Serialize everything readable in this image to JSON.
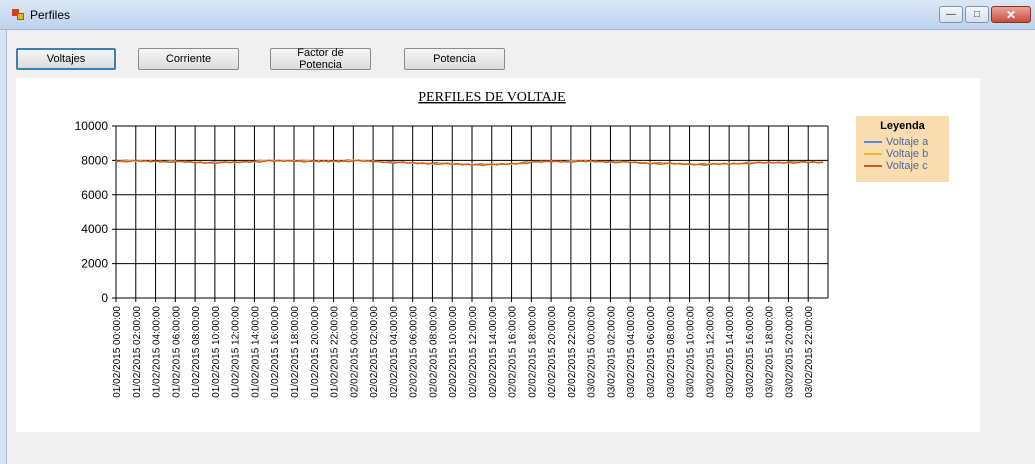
{
  "window": {
    "title": "Perfiles",
    "controls": [
      "minimize",
      "maximize",
      "close"
    ]
  },
  "toolbar": {
    "buttons": [
      {
        "label": "Voltajes",
        "active": true
      },
      {
        "label": "Corriente",
        "active": false
      },
      {
        "label": "Factor de Potencia",
        "active": false
      },
      {
        "label": "Potencia",
        "active": false
      }
    ]
  },
  "legend": {
    "title": "Leyenda",
    "items": [
      {
        "label": "Voltaje a",
        "color": "#4a90d9"
      },
      {
        "label": "Voltaje b",
        "color": "#f4b820"
      },
      {
        "label": "Voltaje c",
        "color": "#d9531e"
      }
    ]
  },
  "chart_data": {
    "type": "line",
    "title": "PERFILES DE VOLTAJE",
    "xlabel": "",
    "ylabel": "",
    "ylim": [
      0,
      10000
    ],
    "yticks": [
      0,
      2000,
      4000,
      6000,
      8000,
      10000
    ],
    "grid": true,
    "legend_position": "top-right",
    "categories": [
      "01/02/2015 00:00:00",
      "01/02/2015 02:00:00",
      "01/02/2015 04:00:00",
      "01/02/2015 06:00:00",
      "01/02/2015 08:00:00",
      "01/02/2015 10:00:00",
      "01/02/2015 12:00:00",
      "01/02/2015 14:00:00",
      "01/02/2015 16:00:00",
      "01/02/2015 18:00:00",
      "01/02/2015 20:00:00",
      "01/02/2015 22:00:00",
      "02/02/2015 00:00:00",
      "02/02/2015 02:00:00",
      "02/02/2015 04:00:00",
      "02/02/2015 06:00:00",
      "02/02/2015 08:00:00",
      "02/02/2015 10:00:00",
      "02/02/2015 12:00:00",
      "02/02/2015 14:00:00",
      "02/02/2015 16:00:00",
      "02/02/2015 18:00:00",
      "02/02/2015 20:00:00",
      "02/02/2015 22:00:00",
      "03/02/2015 00:00:00",
      "03/02/2015 02:00:00",
      "03/02/2015 04:00:00",
      "03/02/2015 06:00:00",
      "03/02/2015 08:00:00",
      "03/02/2015 10:00:00",
      "03/02/2015 12:00:00",
      "03/02/2015 14:00:00",
      "03/02/2015 16:00:00",
      "03/02/2015 18:00:00",
      "03/02/2015 20:00:00",
      "03/02/2015 22:00:00"
    ],
    "series": [
      {
        "name": "Voltaje a",
        "color": "#4a90d9",
        "values": [
          7980,
          7970,
          7960,
          7940,
          7900,
          7880,
          7900,
          7960,
          7980,
          7990,
          7950,
          7970,
          7990,
          7960,
          7900,
          7860,
          7840,
          7800,
          7780,
          7760,
          7820,
          7900,
          7960,
          7950,
          7960,
          7930,
          7900,
          7850,
          7820,
          7800,
          7780,
          7820,
          7860,
          7880,
          7900,
          7900
        ]
      },
      {
        "name": "Voltaje b",
        "color": "#f4b820",
        "values": [
          7970,
          7960,
          7950,
          7930,
          7890,
          7870,
          7890,
          7950,
          7970,
          7980,
          7940,
          7960,
          7980,
          7950,
          7890,
          7850,
          7830,
          7790,
          7770,
          7750,
          7810,
          7890,
          7950,
          7940,
          7950,
          7920,
          7890,
          7840,
          7810,
          7790,
          7770,
          7810,
          7850,
          7870,
          7890,
          7890
        ]
      },
      {
        "name": "Voltaje c",
        "color": "#d9531e",
        "values": [
          7960,
          7950,
          7940,
          7920,
          7880,
          7860,
          7880,
          7940,
          7960,
          7970,
          7930,
          7950,
          7970,
          7940,
          7880,
          7840,
          7820,
          7780,
          7760,
          7740,
          7800,
          7880,
          7940,
          7930,
          7940,
          7910,
          7880,
          7830,
          7800,
          7780,
          7760,
          7800,
          7840,
          7860,
          7880,
          7880
        ]
      }
    ]
  }
}
